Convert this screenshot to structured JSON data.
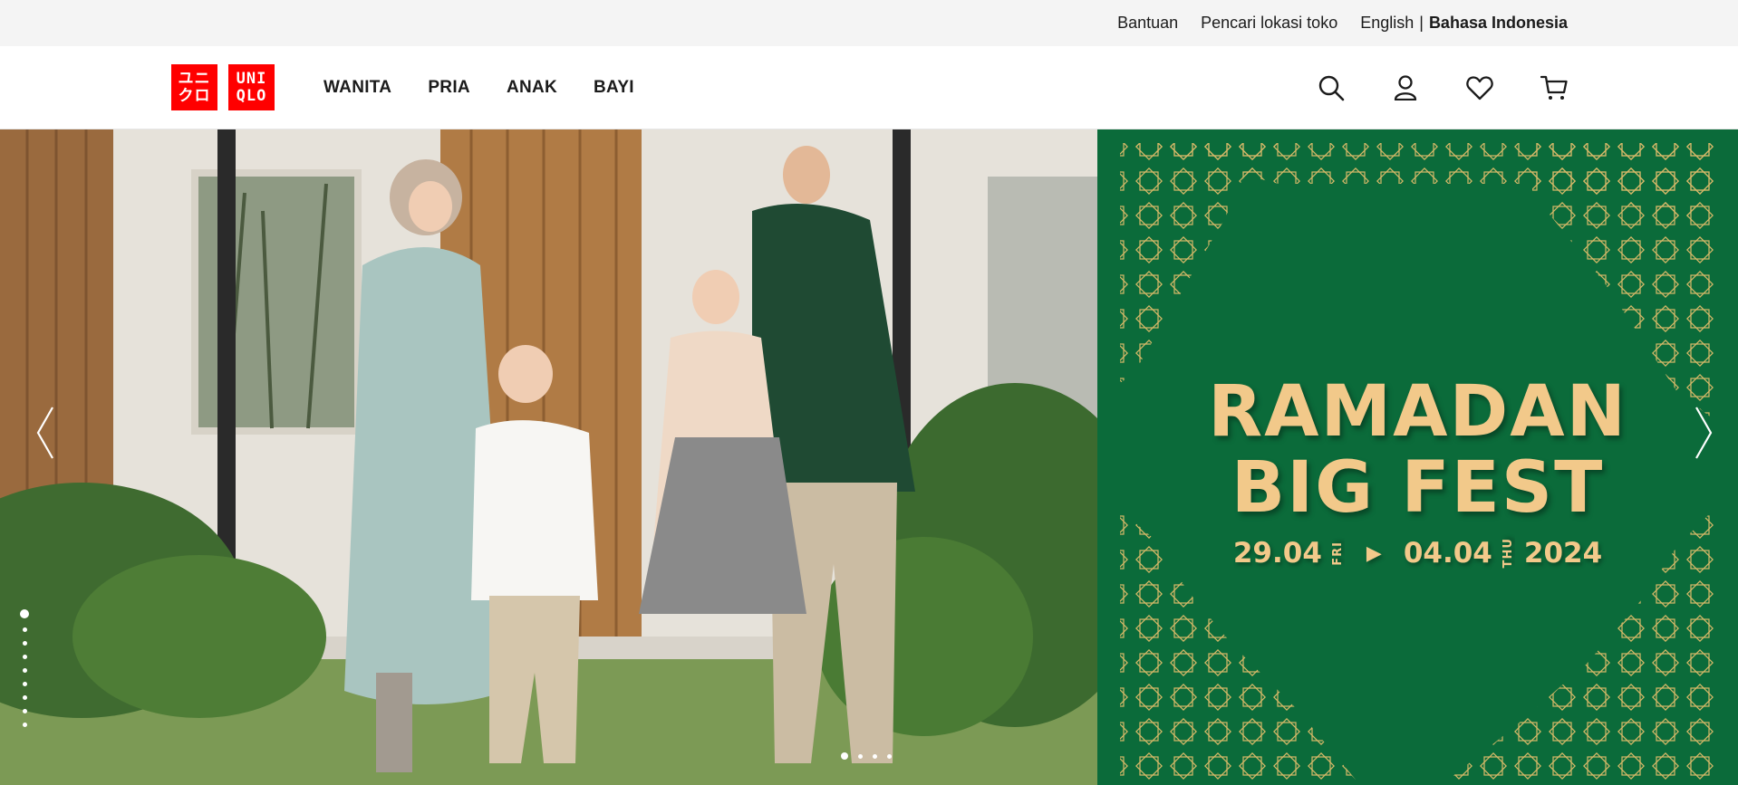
{
  "utility": {
    "help": "Bantuan",
    "store_locator": "Pencari lokasi toko",
    "lang_english": "English",
    "lang_separator": "|",
    "lang_indonesian": "Bahasa Indonesia"
  },
  "logo": {
    "line1_left": "ユニ",
    "line2_left": "クロ",
    "line1_right": "UNI",
    "line2_right": "QLO",
    "color": "#ff0000"
  },
  "nav": {
    "items": [
      "WANITA",
      "PRIA",
      "ANAK",
      "BAYI"
    ]
  },
  "header_icons": [
    "search-icon",
    "account-icon",
    "wishlist-heart-icon",
    "cart-icon"
  ],
  "hero": {
    "promo": {
      "line1": "RAMADAN",
      "line2": "BIG FEST",
      "date_start": "29.04",
      "day_start": "FRI",
      "date_end": "04.04",
      "day_end": "THU",
      "year": "2024",
      "bg_color": "#0b6b3a",
      "text_color": "#f2c98a"
    },
    "vertical_dots_count": 9,
    "horizontal_dots_count": 4
  }
}
